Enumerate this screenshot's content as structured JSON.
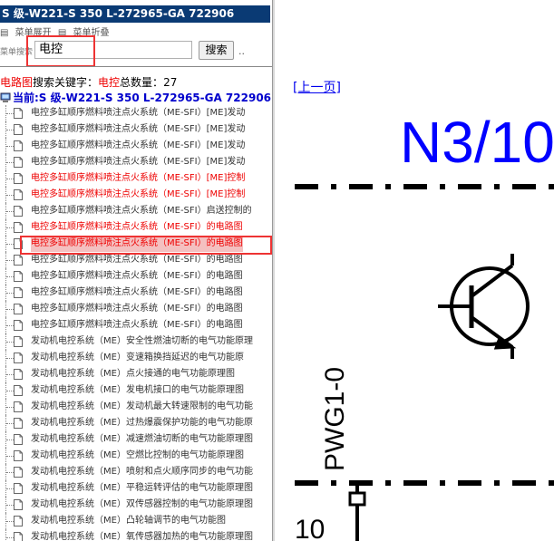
{
  "left_panel": {
    "title": "S 级-W221-S 350 L-272965-GA 722906",
    "menu": {
      "expand": "菜单展开",
      "collapse": "菜单折叠"
    },
    "search": {
      "label": "菜单搜索",
      "value": "电控",
      "button": "搜索",
      "ellipsis": ".."
    },
    "summary": {
      "category": "电路图",
      "keyword_label": "搜索关键字：",
      "keyword": "电控",
      "count_label": "总数量：",
      "count": "27"
    },
    "current": "当前:S 级-W221-S 350 L-272965-GA 722906",
    "tree_items": [
      {
        "text": "电控多缸顺序燃料喷注点火系统（ME-SFI）[ME]发动",
        "color": "normal"
      },
      {
        "text": "电控多缸顺序燃料喷注点火系统（ME-SFI）[ME]发动",
        "color": "normal"
      },
      {
        "text": "电控多缸顺序燃料喷注点火系统（ME-SFI）[ME]发动",
        "color": "normal"
      },
      {
        "text": "电控多缸顺序燃料喷注点火系统（ME-SFI）[ME]发动",
        "color": "normal"
      },
      {
        "text": "电控多缸顺序燃料喷注点火系统（ME-SFI）[ME]控制",
        "color": "red"
      },
      {
        "text": "电控多缸顺序燃料喷注点火系统（ME-SFI）[ME]控制",
        "color": "red"
      },
      {
        "text": "电控多缸顺序燃料喷注点火系统（ME-SFI）启送控制的",
        "color": "normal"
      },
      {
        "text": "电控多缸顺序燃料喷注点火系统（ME-SFI）的电路图",
        "color": "red"
      },
      {
        "text": "电控多缸顺序燃料喷注点火系统（ME-SFI）的电路图",
        "color": "red",
        "selected": true
      },
      {
        "text": "电控多缸顺序燃料喷注点火系统（ME-SFI）的电路图",
        "color": "normal"
      },
      {
        "text": "电控多缸顺序燃料喷注点火系统（ME-SFI）的电路图",
        "color": "normal"
      },
      {
        "text": "电控多缸顺序燃料喷注点火系统（ME-SFI）的电路图",
        "color": "normal"
      },
      {
        "text": "电控多缸顺序燃料喷注点火系统（ME-SFI）的电路图",
        "color": "normal"
      },
      {
        "text": "电控多缸顺序燃料喷注点火系统（ME-SFI）的电路图",
        "color": "normal"
      },
      {
        "text": "发动机电控系统（ME）安全性燃油切断的电气功能原理",
        "color": "normal"
      },
      {
        "text": "发动机电控系统（ME）变速箱换挡延迟的电气功能原",
        "color": "normal"
      },
      {
        "text": "发动机电控系统（ME）点火接通的电气功能原理图",
        "color": "normal"
      },
      {
        "text": "发动机电控系统（ME）发电机接口的电气功能原理图",
        "color": "normal"
      },
      {
        "text": "发动机电控系统（ME）发动机最大转速限制的电气功能",
        "color": "normal"
      },
      {
        "text": "发动机电控系统（ME）过热爆震保护功能的电气功能原",
        "color": "normal"
      },
      {
        "text": "发动机电控系统（ME）减速燃油切断的电气功能原理图",
        "color": "normal"
      },
      {
        "text": "发动机电控系统（ME）空燃比控制的电气功能原理图",
        "color": "normal"
      },
      {
        "text": "发动机电控系统（ME）喷射和点火顺序同步的电气功能",
        "color": "normal"
      },
      {
        "text": "发动机电控系统（ME）平稳运转评估的电气功能原理图",
        "color": "normal"
      },
      {
        "text": "发动机电控系统（ME）双传感器控制的电气功能原理图",
        "color": "normal"
      },
      {
        "text": "发动机电控系统（ME）凸轮轴调节的电气功能图",
        "color": "normal"
      },
      {
        "text": "发动机电控系统（ME）氧传感器加热的电气功能原理图",
        "color": "normal"
      }
    ]
  },
  "diagram": {
    "prev_link": "[上一页]",
    "title": "N3/10",
    "signal_label": "PWG1-0",
    "pin_number": "10"
  }
}
